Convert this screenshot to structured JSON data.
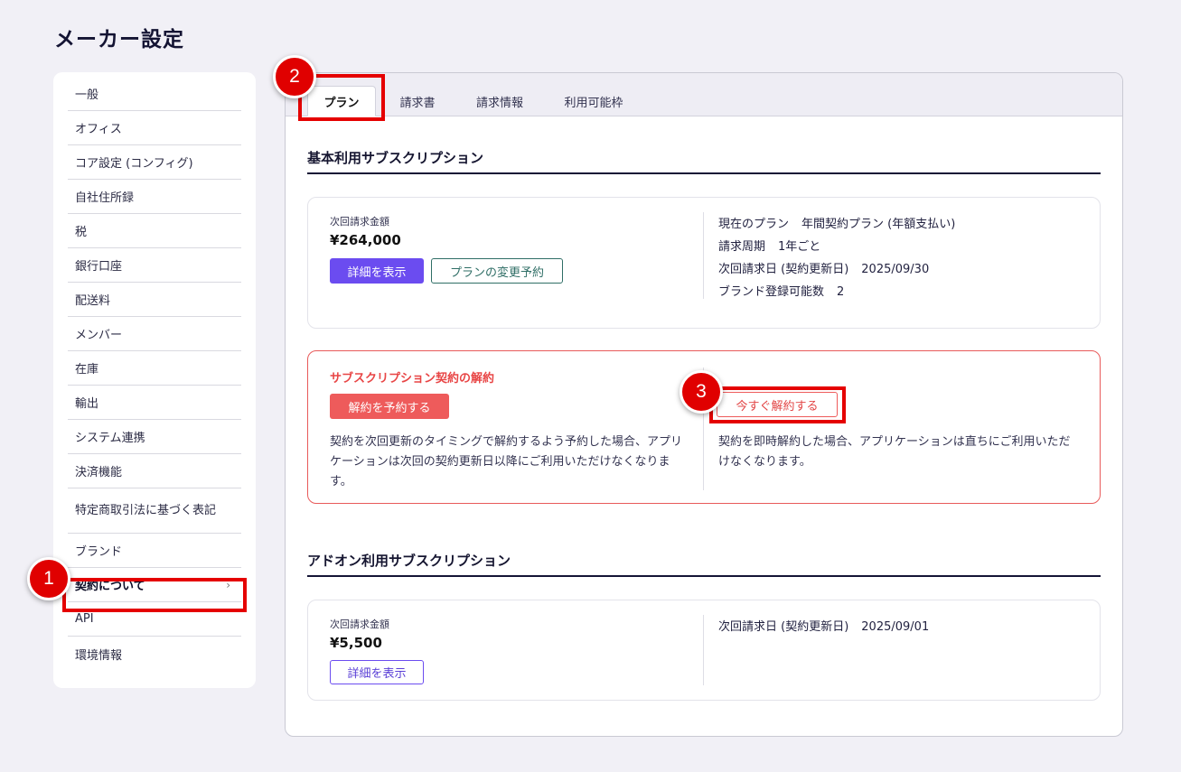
{
  "page": {
    "title": "メーカー設定"
  },
  "sidebar": {
    "items": [
      {
        "label": "一般"
      },
      {
        "label": "オフィス"
      },
      {
        "label": "コア設定 (コンフィグ)"
      },
      {
        "label": "自社住所録"
      },
      {
        "label": "税"
      },
      {
        "label": "銀行口座"
      },
      {
        "label": "配送料"
      },
      {
        "label": "メンバー"
      },
      {
        "label": "在庫"
      },
      {
        "label": "輸出"
      },
      {
        "label": "システム連携"
      },
      {
        "label": "決済機能"
      },
      {
        "label": "特定商取引法に基づく表記"
      },
      {
        "label": "ブランド"
      },
      {
        "label": "契約について",
        "chevron": "›"
      },
      {
        "label": "API"
      },
      {
        "label": "環境情報"
      }
    ]
  },
  "annotations": {
    "step1": "1",
    "step2": "2",
    "step3": "3"
  },
  "tabs": [
    {
      "label": "プラン"
    },
    {
      "label": "請求書"
    },
    {
      "label": "請求情報"
    },
    {
      "label": "利用可能枠"
    }
  ],
  "basic": {
    "section_title": "基本利用サブスクリプション",
    "next_amount_label": "次回請求金額",
    "next_amount": "¥264,000",
    "details_button": "詳細を表示",
    "change_plan_button": "プランの変更予約",
    "info": [
      {
        "label": "現在のプラン",
        "value": "年間契約プラン (年額支払い)"
      },
      {
        "label": "請求周期",
        "value": "1年ごと"
      },
      {
        "label": "次回請求日 (契約更新日)",
        "value": "2025/09/30"
      },
      {
        "label": "ブランド登録可能数",
        "value": "2"
      }
    ]
  },
  "cancel": {
    "title": "サブスクリプション契約の解約",
    "reserve_button": "解約を予約する",
    "reserve_desc": "契約を次回更新のタイミングで解約するよう予約した場合、アプリケーションは次回の契約更新日以降にご利用いただけなくなります。",
    "now_button": "今すぐ解約する",
    "now_desc": "契約を即時解約した場合、アプリケーションは直ちにご利用いただけなくなります。"
  },
  "addon": {
    "section_title": "アドオン利用サブスクリプション",
    "next_amount_label": "次回請求金額",
    "next_amount": "¥5,500",
    "details_button": "詳細を表示",
    "info": [
      {
        "label": "次回請求日 (契約更新日)",
        "value": "2025/09/01"
      }
    ]
  },
  "colors": {
    "accent": "#6b4cf0",
    "danger": "#ee5b5b",
    "highlight": "#e50000"
  }
}
